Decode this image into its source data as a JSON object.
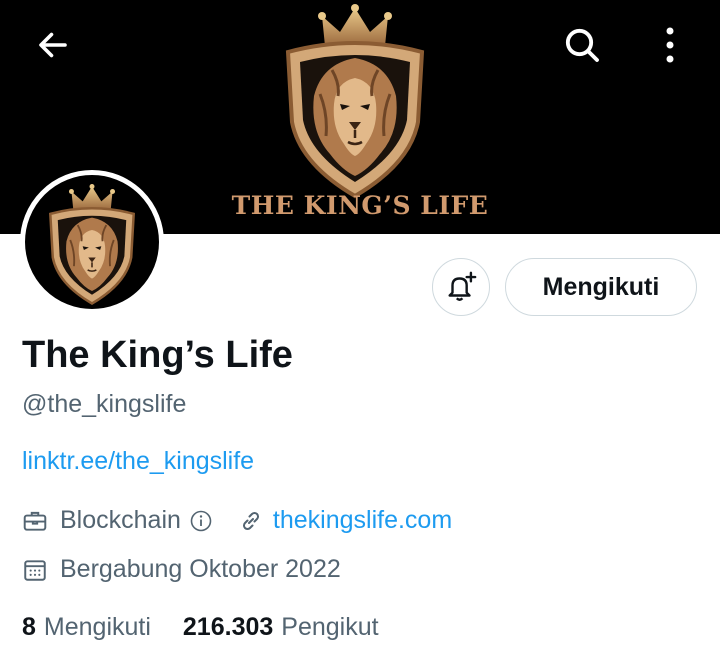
{
  "header": {
    "banner_title": "THE KING’S LIFE",
    "icons": {
      "back": "arrow-left-icon",
      "search": "search-icon",
      "more": "more-vertical-icon"
    }
  },
  "profile": {
    "name": "The King’s Life",
    "handle": "@the_kingslife",
    "bio_link": "linktr.ee/the_kingslife",
    "category": "Blockchain",
    "website": "thekingslife.com",
    "joined": "Bergabung Oktober 2022"
  },
  "actions": {
    "notify_icon": "bell-plus-icon",
    "follow_label": "Mengikuti"
  },
  "stats": {
    "following_count": "8",
    "following_label": "Mengikuti",
    "followers_count": "216.303",
    "followers_label": "Pengikut"
  },
  "colors": {
    "banner_bg": "#000000",
    "banner_gold": "#d19a6e",
    "link_blue": "#1d9bf0",
    "secondary_text": "#536471",
    "primary_text": "#0f1419",
    "button_border": "#cfd9de"
  }
}
